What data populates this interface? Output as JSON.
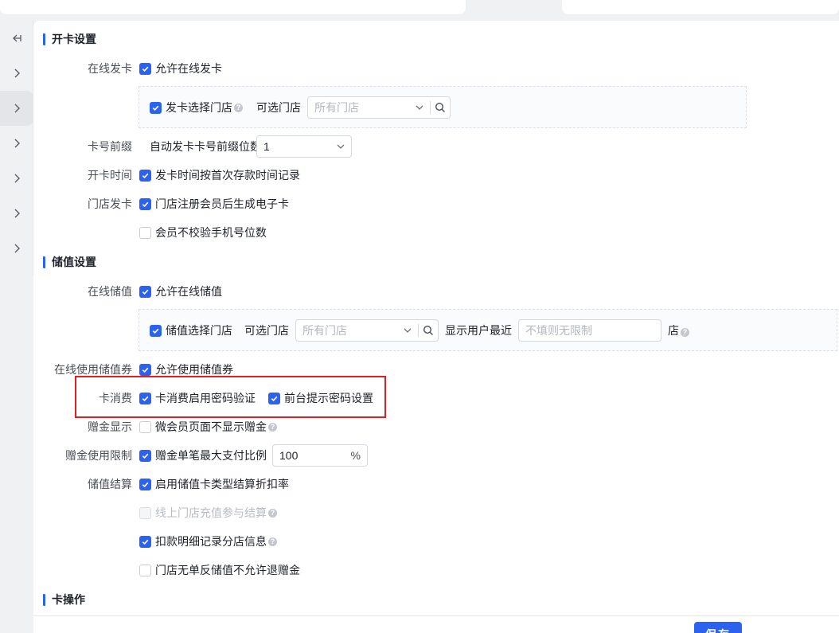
{
  "colors": {
    "accent": "#2b62f0",
    "highlight_border": "#e02020"
  },
  "rail": {
    "items": [
      "collapse-icon",
      "chevron-right-icon",
      "chevron-right-icon",
      "chevron-right-icon",
      "chevron-right-icon",
      "chevron-right-icon",
      "chevron-right-icon"
    ]
  },
  "card_open": {
    "title": "开卡设置",
    "online_issue_label": "在线发卡",
    "online_issue_check": "允许在线发卡",
    "issue_store_check": "发卡选择门店",
    "optional_store_label": "可选门店",
    "optional_store_placeholder": "所有门店",
    "prefix_label": "卡号前缀",
    "prefix_text": "自动发卡卡号前缀位数",
    "prefix_value": "1",
    "open_time_label": "开卡时间",
    "open_time_check": "发卡时间按首次存款时间记录",
    "store_issue_label": "门店发卡",
    "store_issue_check": "门店注册会员后生成电子卡",
    "no_phone_check": "会员不校验手机号位数"
  },
  "stored_value": {
    "title": "储值设置",
    "online_sv_label": "在线储值",
    "online_sv_check": "允许在线储值",
    "sv_store_check": "储值选择门店",
    "optional_store_label": "可选门店",
    "optional_store_placeholder": "所有门店",
    "show_recent_label": "显示用户最近",
    "recent_placeholder": "不填则无限制",
    "store_suffix": "店",
    "coupon_label": "在线使用储值券",
    "coupon_check": "允许使用储值券",
    "card_consume_label": "卡消费",
    "card_consume_check": "卡消费启用密码验证",
    "front_prompt_check": "前台提示密码设置",
    "gift_display_label": "赠金显示",
    "gift_display_check": "微会员页面不显示赠金",
    "gift_limit_label": "赠金使用限制",
    "gift_limit_check": "赠金单笔最大支付比例",
    "gift_limit_value": "100",
    "gift_limit_unit": "%",
    "settle_label": "储值结算",
    "settle_check": "启用储值卡类型结算折扣率",
    "online_recharge_check": "线上门店充值参与结算",
    "deduct_detail_check": "扣款明细记录分店信息",
    "no_refund_check": "门店无单反储值不允许退赠金"
  },
  "card_ops": {
    "title": "卡操作"
  },
  "footer": {
    "save_label": "保存"
  }
}
